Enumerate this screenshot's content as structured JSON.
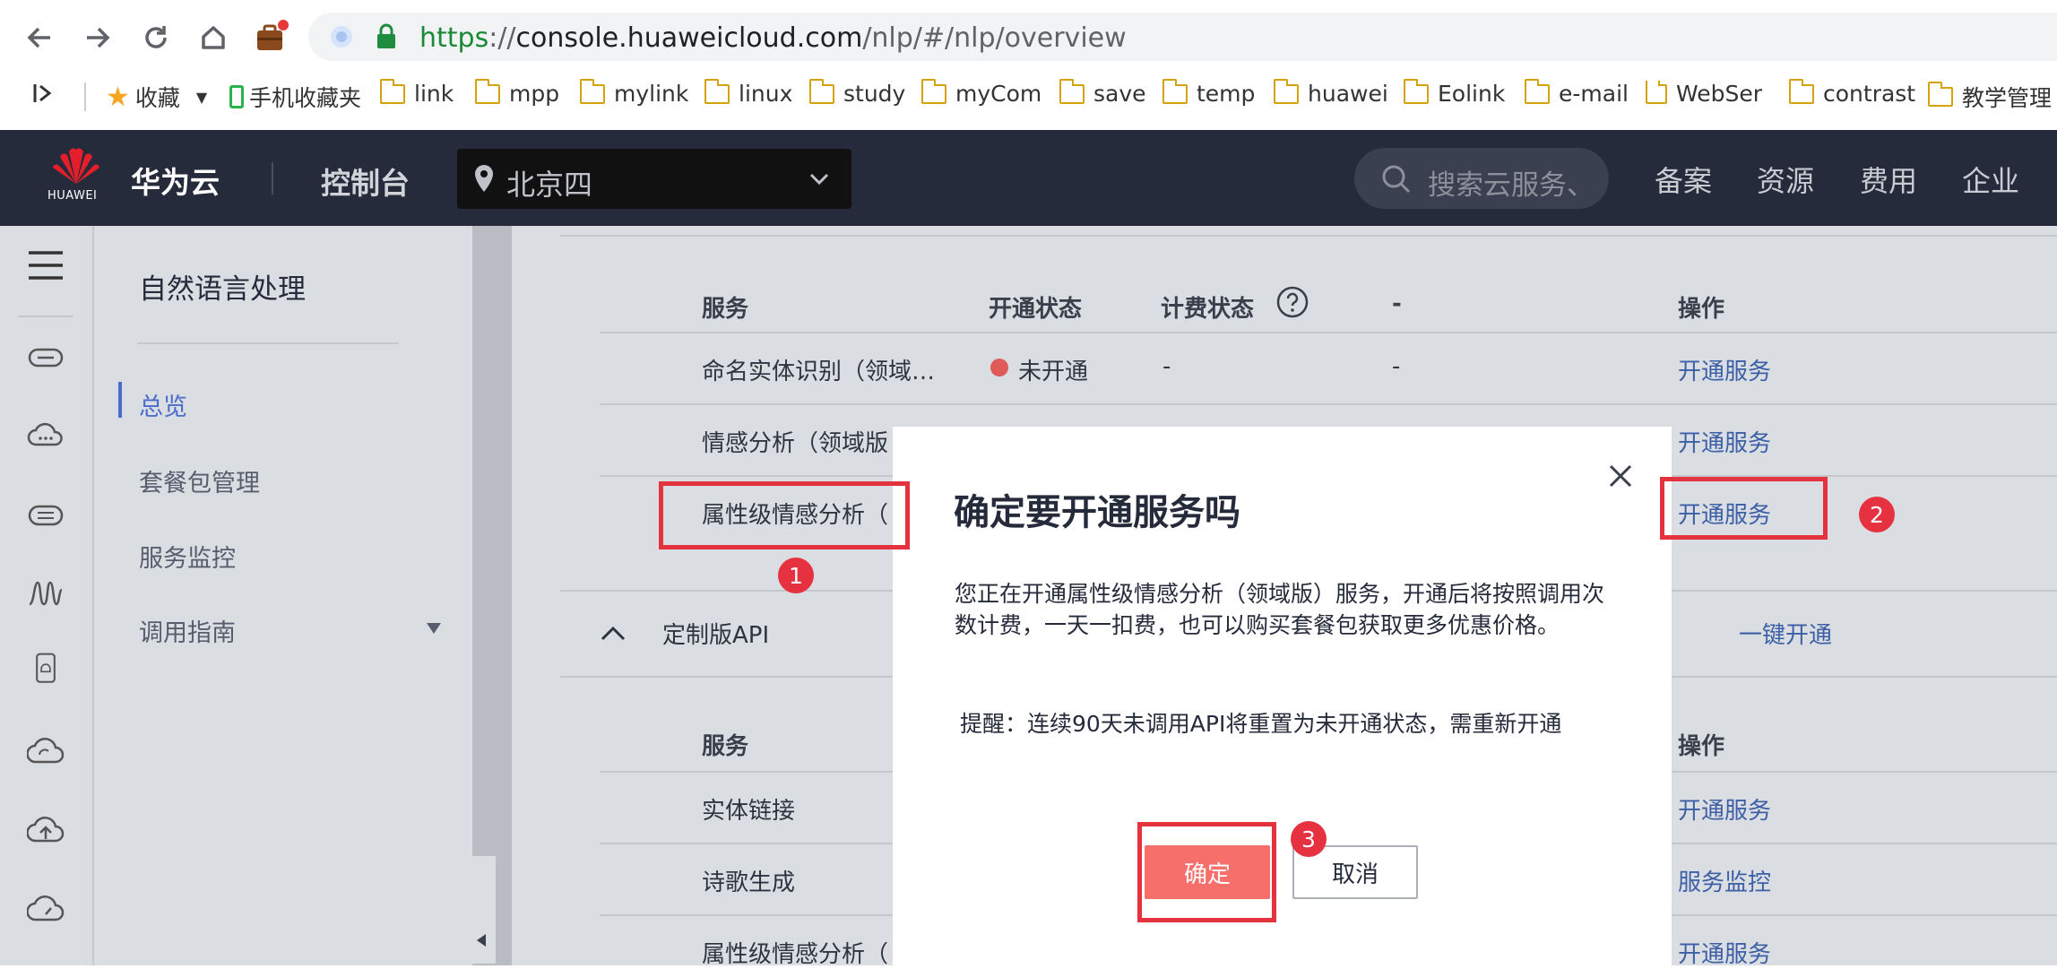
{
  "browser": {
    "url_scheme": "https",
    "url_sep": "://",
    "url_host": "console.huaweicloud.com",
    "url_path": "/nlp/#/nlp/overview",
    "bookmarks": [
      "收藏",
      "手机收藏夹",
      "link",
      "mpp",
      "mylink",
      "linux",
      "study",
      "myCom",
      "save",
      "temp",
      "huawei",
      "Eolink",
      "e-mail",
      "WebSer",
      "contrast",
      "教学管理"
    ]
  },
  "topbar": {
    "logo_caption": "HUAWEI",
    "brand": "华为云",
    "console": "控制台",
    "region": "北京四",
    "search_placeholder": "搜索云服务、",
    "nav": [
      "备案",
      "资源",
      "费用",
      "企业"
    ]
  },
  "sidenav": {
    "title": "自然语言处理",
    "items": [
      "总览",
      "套餐包管理",
      "服务监控",
      "调用指南"
    ],
    "active_index": 0
  },
  "table1": {
    "headers": {
      "service": "服务",
      "status": "开通状态",
      "billing": "计费状态",
      "dash": "-",
      "action": "操作"
    },
    "rows": [
      {
        "service": "命名实体识别（领域…",
        "status": "未开通",
        "billing": "-",
        "dash": "-",
        "action": "开通服务"
      },
      {
        "service": "情感分析（领域版",
        "action": "开通服务"
      },
      {
        "service": "属性级情感分析（",
        "action": "开通服务"
      }
    ]
  },
  "section2": {
    "title": "定制版API",
    "action": "一键开通"
  },
  "table2": {
    "headers": {
      "service": "服务",
      "action": "操作"
    },
    "rows": [
      {
        "service": "实体链接",
        "action": "开通服务"
      },
      {
        "service": "诗歌生成",
        "action": "服务监控"
      },
      {
        "service": "属性级情感分析（",
        "action": "开通服务"
      }
    ]
  },
  "modal": {
    "title": "确定要开通服务吗",
    "body": "您正在开通属性级情感分析（领域版）服务，开通后将按照调用次数计费，一天一扣费，也可以购买套餐包获取更多优惠价格。",
    "tip": "提醒：连续90天未调用API将重置为未开通状态，需重新开通",
    "ok": "确定",
    "cancel": "取消"
  },
  "annotations": [
    "1",
    "2",
    "3"
  ],
  "colors": {
    "topbar_bg": "#252b3a",
    "link": "#3c5fa6",
    "status_off": "#e05a5a",
    "primary_button": "#f66f6a",
    "annotation_red": "#e5323f"
  }
}
